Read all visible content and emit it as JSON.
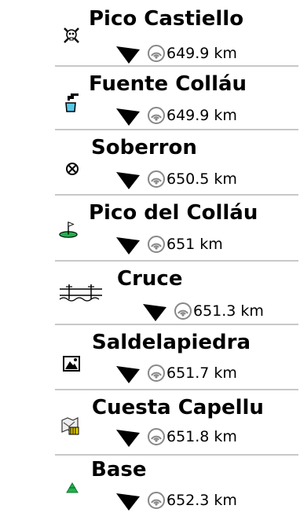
{
  "waypoints": [
    {
      "name": "Pico Castiello",
      "distance": "649.9 km",
      "icon": "skull-icon"
    },
    {
      "name": "Fuente Colláu",
      "distance": "649.9 km",
      "icon": "water-tap-icon"
    },
    {
      "name": "Soberron",
      "distance": "650.5 km",
      "icon": "crossed-circle-icon"
    },
    {
      "name": "Pico del Colláu",
      "distance": "651 km",
      "icon": "golf-flag-icon"
    },
    {
      "name": "Cruce",
      "distance": "651.3 km",
      "icon": "railroad-crossing-icon"
    },
    {
      "name": "Saldelapiedra",
      "distance": "651.7 km",
      "icon": "picture-icon"
    },
    {
      "name": "Cuesta Capellu",
      "distance": "651.8 km",
      "icon": "map-cache-icon"
    },
    {
      "name": "Base",
      "distance": "652.3 km",
      "icon": "green-triangle-icon"
    }
  ],
  "colors": {
    "divider": "#c8c8c8",
    "gps_icon": "#888888",
    "flag_green": "#22b14c"
  }
}
